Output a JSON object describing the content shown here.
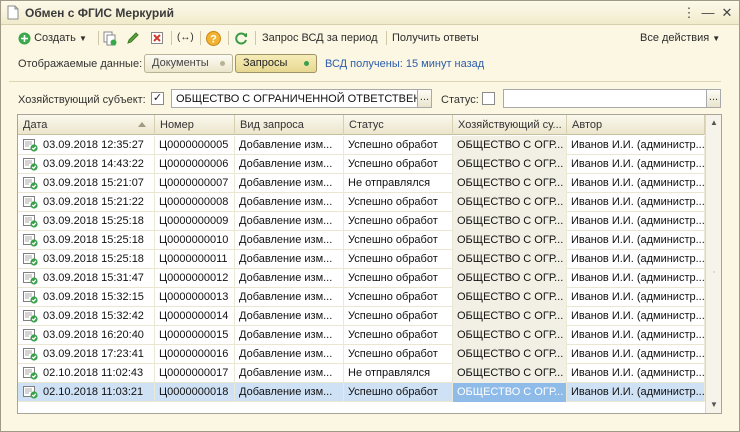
{
  "window": {
    "title": "Обмен с ФГИС Меркурий"
  },
  "toolbar": {
    "create_label": "Создать",
    "request_vsd_label": "Запрос ВСД за период",
    "get_answers_label": "Получить ответы",
    "all_actions_label": "Все действия"
  },
  "display": {
    "label": "Отображаемые данные:",
    "options": [
      "Документы",
      "Запросы"
    ],
    "selected": "Запросы",
    "vsd_status": "ВСД получены: 15 минут назад"
  },
  "filter": {
    "subject_label": "Хозяйствующий субъект:",
    "subject_checked": true,
    "subject_value": "ОБЩЕСТВО С ОГРАНИЧЕННОЙ ОТВЕТСТВЕН",
    "status_label": "Статус:",
    "status_checked": false,
    "status_value": ""
  },
  "table": {
    "columns": [
      "Дата",
      "Номер",
      "Вид запроса",
      "Статус",
      "Хозяйствующий су...",
      "Автор"
    ],
    "rows": [
      [
        "03.09.2018 12:35:27",
        "Ц0000000005",
        "Добавление изм...",
        "Успешно обработ",
        "ОБЩЕСТВО С ОГР...",
        "Иванов И.И. (администр..."
      ],
      [
        "03.09.2018 14:43:22",
        "Ц0000000006",
        "Добавление изм...",
        "Успешно обработ",
        "ОБЩЕСТВО С ОГР...",
        "Иванов И.И. (администр..."
      ],
      [
        "03.09.2018 15:21:07",
        "Ц0000000007",
        "Добавление изм...",
        "Не отправлялся",
        "ОБЩЕСТВО С ОГР...",
        "Иванов И.И. (администр..."
      ],
      [
        "03.09.2018 15:21:22",
        "Ц0000000008",
        "Добавление изм...",
        "Успешно обработ",
        "ОБЩЕСТВО С ОГР...",
        "Иванов И.И. (администр..."
      ],
      [
        "03.09.2018 15:25:18",
        "Ц0000000009",
        "Добавление изм...",
        "Успешно обработ",
        "ОБЩЕСТВО С ОГР...",
        "Иванов И.И. (администр..."
      ],
      [
        "03.09.2018 15:25:18",
        "Ц0000000010",
        "Добавление изм...",
        "Успешно обработ",
        "ОБЩЕСТВО С ОГР...",
        "Иванов И.И. (администр..."
      ],
      [
        "03.09.2018 15:25:18",
        "Ц0000000011",
        "Добавление изм...",
        "Успешно обработ",
        "ОБЩЕСТВО С ОГР...",
        "Иванов И.И. (администр..."
      ],
      [
        "03.09.2018 15:31:47",
        "Ц0000000012",
        "Добавление изм...",
        "Успешно обработ",
        "ОБЩЕСТВО С ОГР...",
        "Иванов И.И. (администр..."
      ],
      [
        "03.09.2018 15:32:15",
        "Ц0000000013",
        "Добавление изм...",
        "Успешно обработ",
        "ОБЩЕСТВО С ОГР...",
        "Иванов И.И. (администр..."
      ],
      [
        "03.09.2018 15:32:42",
        "Ц0000000014",
        "Добавление изм...",
        "Успешно обработ",
        "ОБЩЕСТВО С ОГР...",
        "Иванов И.И. (администр..."
      ],
      [
        "03.09.2018 16:20:40",
        "Ц0000000015",
        "Добавление изм...",
        "Успешно обработ",
        "ОБЩЕСТВО С ОГР...",
        "Иванов И.И. (администр..."
      ],
      [
        "03.09.2018 17:23:41",
        "Ц0000000016",
        "Добавление изм...",
        "Успешно обработ",
        "ОБЩЕСТВО С ОГР...",
        "Иванов И.И. (администр..."
      ],
      [
        "02.10.2018 11:02:43",
        "Ц0000000017",
        "Добавление изм...",
        "Не отправлялся",
        "ОБЩЕСТВО С ОГР...",
        "Иванов И.И. (администр..."
      ],
      [
        "02.10.2018 11:03:21",
        "Ц0000000018",
        "Добавление изм...",
        "Успешно обработ",
        "ОБЩЕСТВО С ОГР...",
        "Иванов И.И. (администр..."
      ]
    ],
    "selected_row": 13
  },
  "colors": {
    "accent": "#2d5dab",
    "selection": "#cfe1f5",
    "window_bg": "#fbf7e3",
    "ok_green": "#3aa14a"
  }
}
